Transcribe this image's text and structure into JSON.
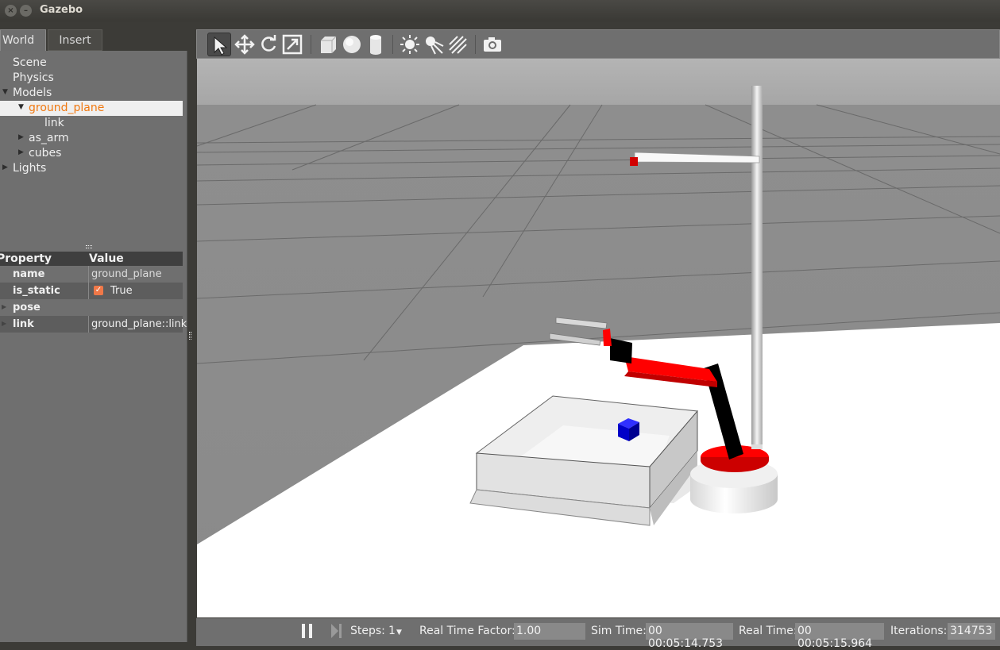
{
  "window": {
    "title": "Gazebo"
  },
  "tabs": [
    {
      "label": "World"
    },
    {
      "label": "Insert"
    }
  ],
  "tree": {
    "items": [
      {
        "label": "Scene"
      },
      {
        "label": "Physics"
      },
      {
        "label": "Models"
      },
      {
        "label": "ground_plane"
      },
      {
        "label": "link"
      },
      {
        "label": "as_arm"
      },
      {
        "label": "cubes"
      },
      {
        "label": "Lights"
      }
    ]
  },
  "properties": {
    "headers": {
      "property": "Property",
      "value": "Value"
    },
    "rows": [
      {
        "key": "name",
        "value": "ground_plane"
      },
      {
        "key": "is_static",
        "value": "True"
      },
      {
        "key": "pose",
        "value": ""
      },
      {
        "key": "link",
        "value": "ground_plane::link"
      }
    ]
  },
  "toolbar": {
    "icons": [
      "select-cursor-icon",
      "translate-icon",
      "rotate-icon",
      "scale-icon",
      "box-icon",
      "sphere-icon",
      "cylinder-icon",
      "point-light-icon",
      "spot-light-icon",
      "directional-light-icon",
      "screenshot-icon"
    ]
  },
  "status": {
    "steps_label": "Steps:",
    "steps_value": "1",
    "rtf_label": "Real Time Factor:",
    "rtf_value": "1.00",
    "sim_time_label": "Sim Time:",
    "sim_time_value": "00 00:05:14.753",
    "real_time_label": "Real Time:",
    "real_time_value": "00 00:05:15.964",
    "iterations_label": "Iterations:",
    "iterations_value": "314753"
  },
  "colors": {
    "selected_text": "#f07810",
    "panel_bg": "#6f6f6f",
    "arm_red": "#ff0000",
    "cube_blue": "#0000dd"
  }
}
